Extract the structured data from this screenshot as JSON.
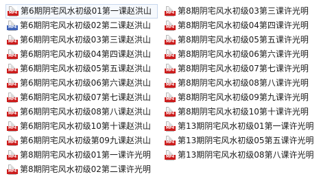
{
  "icon_tag": "MP4",
  "files": {
    "left": [
      {
        "name": "第6期阴宅风水初级01第一课赵洪山",
        "selected": true
      },
      {
        "name": "第6期阴宅风水初级02第二课赵洪山",
        "icon": "alt"
      },
      {
        "name": "第6期阴宅风水初级03第三课赵洪山"
      },
      {
        "name": "第6期阴宅风水初级04第四课赵洪山"
      },
      {
        "name": "第6期阴宅风水初级05第五课赵洪山"
      },
      {
        "name": "第6期阴宅风水初级06第六课赵洪山"
      },
      {
        "name": "第6期阴宅风水初级07第七课赵洪山"
      },
      {
        "name": "第6期阴宅风水初级08第八课赵洪山"
      },
      {
        "name": "第6期阴宅风水初级10第十课赵洪山"
      },
      {
        "name": "第6期阴宅风水初级第09九课赵洪山"
      },
      {
        "name": "第8期阴宅风水初级01第一课许光明"
      },
      {
        "name": "第8期阴宅风水初级02第二课许光明"
      }
    ],
    "right": [
      {
        "name": "第8期阴宅风水初级03第三课许光明"
      },
      {
        "name": "第8期阴宅风水初级04第四课许光明"
      },
      {
        "name": "第8期阴宅风水初级05第五课许光明"
      },
      {
        "name": "第8期阴宅风水初级06第六课许光明"
      },
      {
        "name": "第8期阴宅风水初级07第七课许光明"
      },
      {
        "name": "第8期阴宅风水初级08第八课许光明"
      },
      {
        "name": "第8期阴宅风水初级09第九课许光明"
      },
      {
        "name": "第8期阴宅风水初级10第十课许光明"
      },
      {
        "name": "第13期阴宅风水初级01第一课许光明"
      },
      {
        "name": "第13期阴宅风水初级05第五课许光明"
      },
      {
        "name": "第13期阴宅风水初级08第八课许光明"
      }
    ]
  }
}
